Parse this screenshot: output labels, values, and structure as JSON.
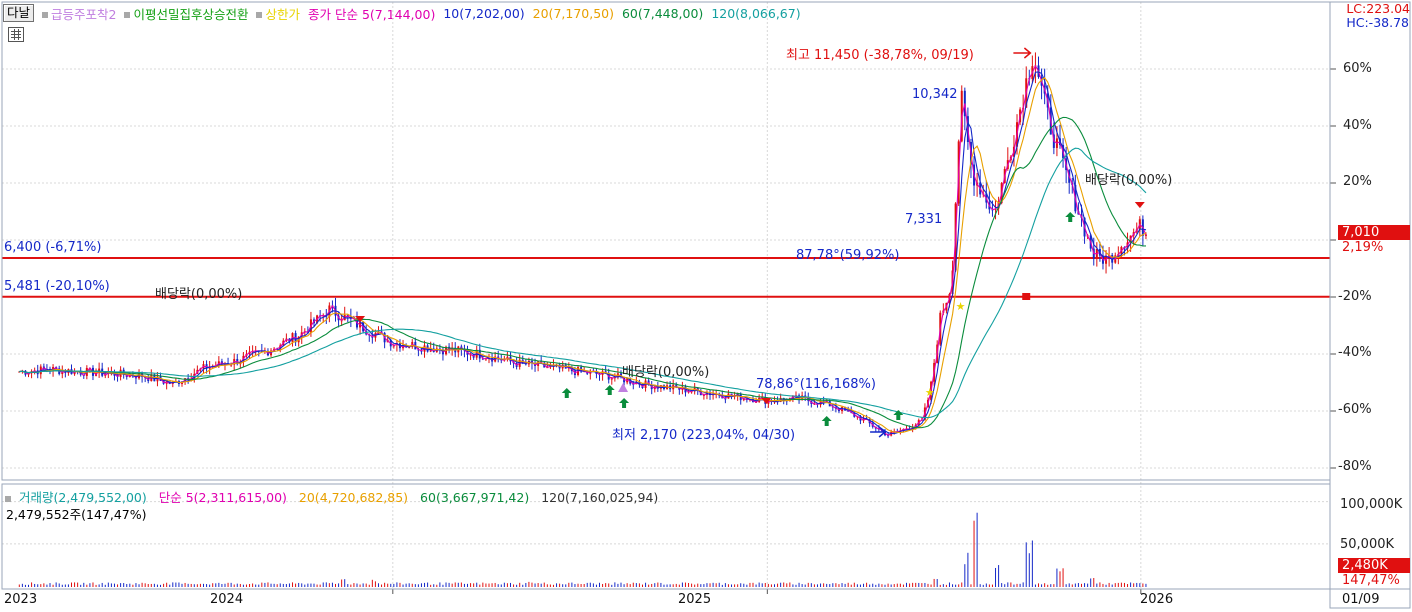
{
  "header": {
    "tab_label": "다날",
    "indicators": [
      {
        "label": "급등주포착2",
        "color": "#c07fe0"
      },
      {
        "label": "이평선밀집후상승전환",
        "color": "#14a014"
      },
      {
        "label": "상한가",
        "color": "#e8d400"
      },
      {
        "label": "종가 단순 5(7,144,00)",
        "color": "#e000b0"
      },
      {
        "label": "10(7,202,00)",
        "color": "#1428c8"
      },
      {
        "label": "20(7,170,50)",
        "color": "#e8a000"
      },
      {
        "label": "60(7,448,00)",
        "color": "#0a8c3c"
      },
      {
        "label": "120(8,066,67)",
        "color": "#14a0a0"
      }
    ],
    "lc_label": "LC:223.04",
    "hc_label": "HC:-38.78"
  },
  "volume_legend": {
    "volume_label": "거래량(2,479,552,00)",
    "ma5_label": "단순 5(2,311,615,00)",
    "ma20_label": "20(4,720,682,85)",
    "ma60_label": "60(3,667,971,42)",
    "ma120_label": "120(7,160,025,94)",
    "volume_value_label": "2,479,552주(147,47%)"
  },
  "chart_data": [
    {
      "type": "line",
      "title": "",
      "x_ticks": [
        "2023",
        "2024",
        "2025",
        "2026",
        "01/09"
      ],
      "y_ticks_percent": [
        "60%",
        "40%",
        "20%",
        "-20%",
        "-40%",
        "-60%",
        "-80%"
      ],
      "ylim_percent": [
        -85,
        65
      ],
      "grid": true,
      "series": [
        {
          "name": "close",
          "color": "#d01818",
          "x": [
            "2023-01-02",
            "2023-02-01",
            "2023-03-01",
            "2023-04-03",
            "2023-05-02",
            "2023-06-01",
            "2023-07-03",
            "2023-08-01",
            "2023-09-01",
            "2023-10-04",
            "2023-11-01",
            "2023-12-01",
            "2024-01-02",
            "2024-02-01",
            "2024-03-04",
            "2024-04-01",
            "2024-05-02",
            "2024-06-03",
            "2024-07-01",
            "2024-08-01",
            "2024-09-02",
            "2024-10-02",
            "2024-11-01",
            "2024-12-02",
            "2025-01-02",
            "2025-02-03",
            "2025-03-04",
            "2025-04-01",
            "2025-04-30",
            "2025-05-15",
            "2025-06-02",
            "2025-06-10",
            "2025-06-20",
            "2025-07-01",
            "2025-07-10",
            "2025-07-21",
            "2025-08-01",
            "2025-08-12",
            "2025-09-01",
            "2025-09-19",
            "2025-10-01",
            "2025-10-20",
            "2025-11-03",
            "2025-11-17",
            "2025-12-01",
            "2025-12-15",
            "2026-01-02",
            "2026-01-09"
          ],
          "y": [
            3700,
            3750,
            3700,
            3650,
            3600,
            3400,
            3800,
            3950,
            4200,
            4600,
            5200,
            4800,
            4400,
            4300,
            4200,
            4100,
            3900,
            3800,
            3700,
            3600,
            3400,
            3300,
            3200,
            3100,
            3000,
            3050,
            2900,
            2600,
            2170,
            2300,
            2500,
            3200,
            5000,
            5800,
            10342,
            8500,
            8000,
            7500,
            9500,
            11450,
            10000,
            8500,
            7500,
            6500,
            6400,
            6800,
            7200,
            7010
          ]
        },
        {
          "name": "MA5",
          "color": "#e000b0"
        },
        {
          "name": "MA10",
          "color": "#1428c8"
        },
        {
          "name": "MA20",
          "color": "#e8a000"
        },
        {
          "name": "MA60",
          "color": "#0a8c3c"
        },
        {
          "name": "MA120",
          "color": "#14a0a0"
        }
      ],
      "price_labels": {
        "high": "최고 11,450 (-38,78%, 09/19)",
        "low": "최저 2,170 (223,04%, 04/30)",
        "peak2": "10,342",
        "mid": "7,331",
        "angle1": "87,78°(59,92%)",
        "angle2": "78,86°(116,168%)",
        "dividend": "배당락(0,00%)",
        "current_price": "7,010",
        "current_pct": "2,19%"
      },
      "horizontal_lines": [
        {
          "value": 6400,
          "label": "6,400 (-6,71%)",
          "color": "#e01010"
        },
        {
          "value": 5481,
          "label": "5,481 (-20,10%)",
          "color": "#e01010"
        }
      ]
    },
    {
      "type": "bar",
      "title": "",
      "y_ticks": [
        "100,000K",
        "50,000K"
      ],
      "current_volume": "2,480K",
      "current_pct": "147,47%",
      "volume_units": "K",
      "ylim": [
        0,
        115000
      ],
      "x": [
        "2023-06",
        "2023-11",
        "2023-12",
        "2024-05",
        "2024-09",
        "2025-06",
        "2025-07",
        "2025-07b",
        "2025-08",
        "2025-09",
        "2025-10",
        "2025-11",
        "2026-01"
      ],
      "values": [
        6000,
        14000,
        10000,
        8000,
        5000,
        12000,
        45000,
        90000,
        30000,
        60000,
        25000,
        15000,
        2480
      ]
    }
  ]
}
